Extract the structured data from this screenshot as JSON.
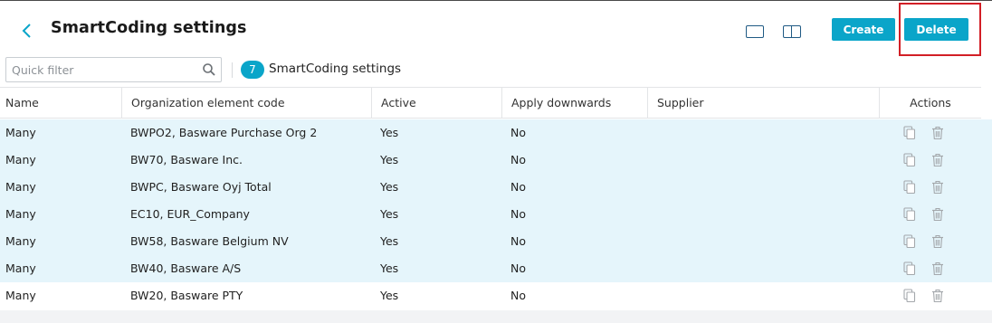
{
  "header": {
    "title": "SmartCoding settings",
    "create_label": "Create",
    "delete_label": "Delete"
  },
  "toolbar": {
    "filter_placeholder": "Quick filter",
    "count": "7",
    "count_label": "SmartCoding settings"
  },
  "table": {
    "columns": [
      "Name",
      "Organization element code",
      "Active",
      "Apply downwards",
      "Supplier",
      "Actions"
    ],
    "rows": [
      {
        "name": "Many",
        "org_code": "BWPO2, Basware Purchase Org 2",
        "active": "Yes",
        "apply_downwards": "No",
        "supplier": "",
        "selected": true
      },
      {
        "name": "Many",
        "org_code": "BW70, Basware Inc.",
        "active": "Yes",
        "apply_downwards": "No",
        "supplier": "",
        "selected": true
      },
      {
        "name": "Many",
        "org_code": "BWPC, Basware Oyj Total",
        "active": "Yes",
        "apply_downwards": "No",
        "supplier": "",
        "selected": true
      },
      {
        "name": "Many",
        "org_code": "EC10, EUR_Company",
        "active": "Yes",
        "apply_downwards": "No",
        "supplier": "",
        "selected": true
      },
      {
        "name": "Many",
        "org_code": "BW58, Basware Belgium NV",
        "active": "Yes",
        "apply_downwards": "No",
        "supplier": "",
        "selected": true
      },
      {
        "name": "Many",
        "org_code": "BW40, Basware A/S",
        "active": "Yes",
        "apply_downwards": "No",
        "supplier": "",
        "selected": true
      },
      {
        "name": "Many",
        "org_code": "BW20, Basware PTY",
        "active": "Yes",
        "apply_downwards": "No",
        "supplier": "",
        "selected": false
      }
    ]
  },
  "colors": {
    "accent": "#0aa5c9",
    "selected_row": "#e5f5fb",
    "highlight_border": "#d21f26",
    "icon_blue": "#1f5a84"
  },
  "icons": {
    "back": "chevron-left-icon",
    "view_single": "single-pane-view-icon",
    "view_split": "split-pane-view-icon",
    "search": "search-icon",
    "copy": "copy-icon",
    "delete": "trash-icon"
  }
}
